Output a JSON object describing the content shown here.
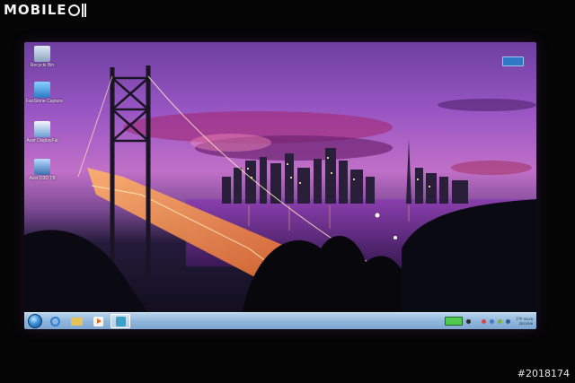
{
  "watermark": {
    "brand": "MOBILE",
    "photo_id": "#2018174"
  },
  "desktop": {
    "icons": [
      {
        "name": "recycle-bin",
        "label": "Recycle Bin"
      },
      {
        "name": "fantastic-capture",
        "label": "FanStone Capture"
      },
      {
        "name": "acer-displayfal",
        "label": "Acer DisplayFal"
      },
      {
        "name": "acer-d3d-tb",
        "label": "Acer D3D TB"
      }
    ]
  },
  "taskbar": {
    "pinned": [
      "internet-explorer",
      "windows-explorer",
      "media-player",
      "active-app"
    ],
    "clock_time": "下午 03:25",
    "clock_date": "2011/5/6"
  },
  "colors": {
    "sky_top": "#6d3fa0",
    "sky_glow": "#c070c7",
    "taskbar": "#90b6dc",
    "bridge_lights": "#ff9a3c"
  }
}
